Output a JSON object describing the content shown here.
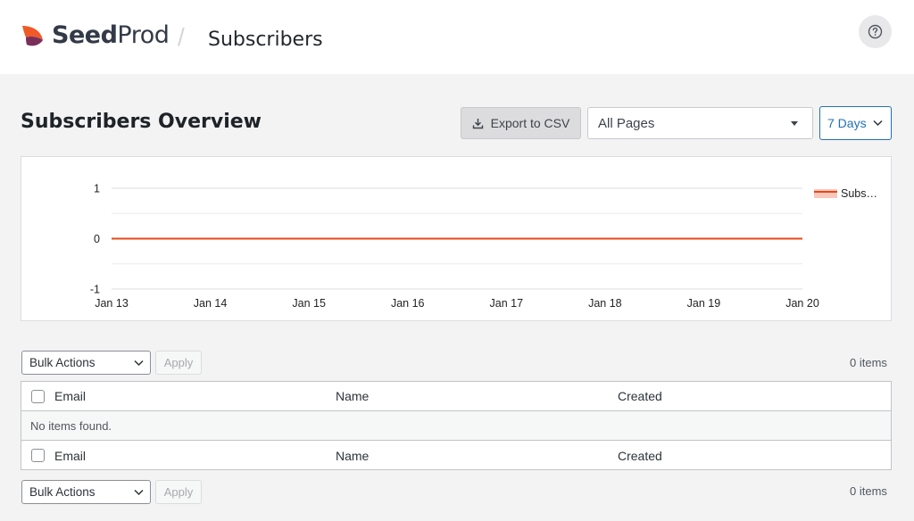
{
  "header": {
    "brand_bold": "Seed",
    "brand_light": "Prod",
    "separator": "/",
    "page_title": "Subscribers"
  },
  "toolbar": {
    "title": "Subscribers Overview",
    "export_label": "Export to CSV",
    "pages_filter": "All Pages",
    "range_filter": "7 Days"
  },
  "colors": {
    "accent": "#2271b1",
    "series": "#e5491b",
    "logo_orange": "#f05a28",
    "logo_purple": "#7a2f5b"
  },
  "chart_data": {
    "type": "line",
    "x": [
      "Jan 13",
      "Jan 14",
      "Jan 15",
      "Jan 16",
      "Jan 17",
      "Jan 18",
      "Jan 19",
      "Jan 20"
    ],
    "series": [
      {
        "name": "Subs…",
        "values": [
          0,
          0,
          0,
          0,
          0,
          0,
          0,
          0
        ]
      }
    ],
    "y_ticks": [
      "1",
      "0",
      "-1"
    ],
    "ylim": [
      -1,
      1
    ],
    "grid": true,
    "legend": "top-right"
  },
  "table": {
    "bulk_actions": "Bulk Actions",
    "apply": "Apply",
    "items_count": "0 items",
    "columns": [
      "Email",
      "Name",
      "Created"
    ],
    "empty_message": "No items found."
  },
  "icons": {
    "help": "help-circle-icon",
    "export": "download-icon",
    "dropdown": "chevron-down-icon"
  }
}
